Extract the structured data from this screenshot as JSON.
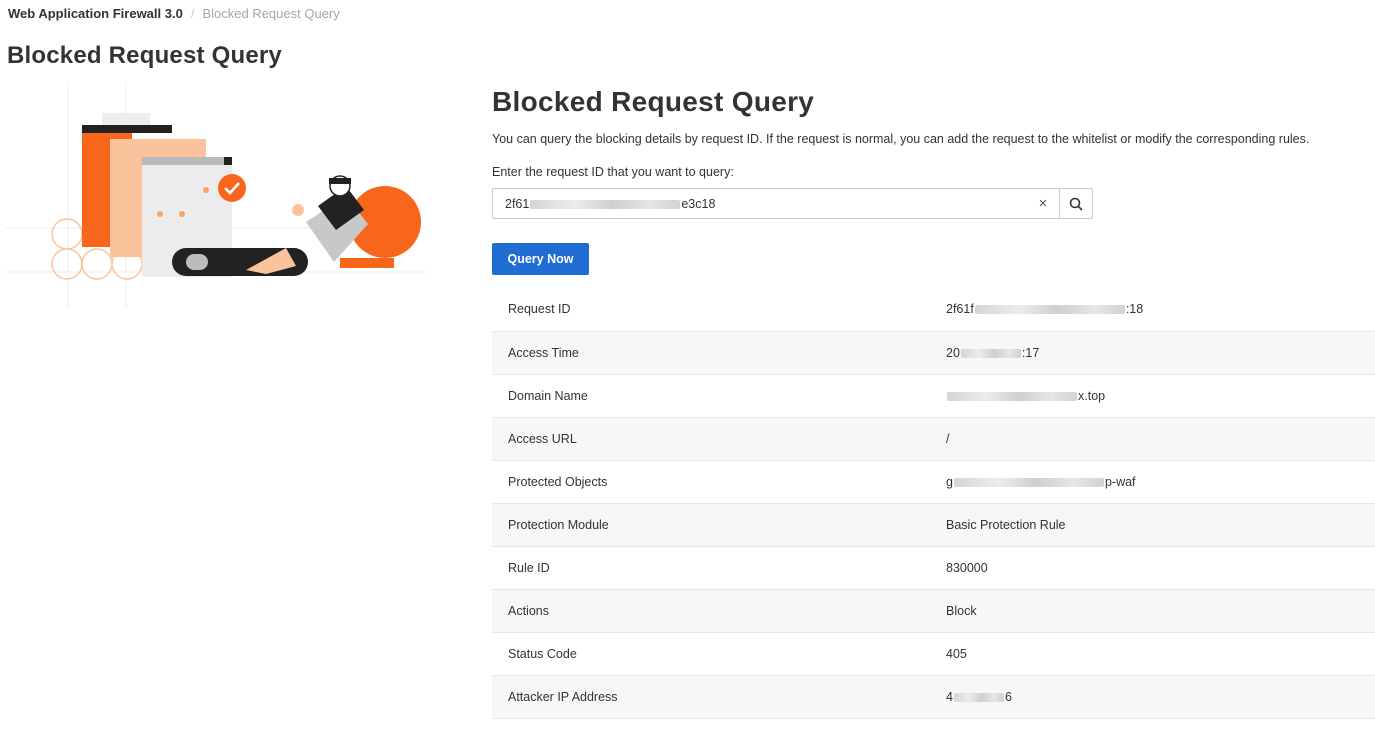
{
  "breadcrumb": {
    "root": "Web Application Firewall 3.0",
    "separator": "/",
    "current": "Blocked Request Query"
  },
  "page_title": "Blocked Request Query",
  "panel": {
    "title": "Blocked Request Query",
    "description": "You can query the blocking details by request ID. If the request is normal, you can add the request to the whitelist or modify the corresponding rules.",
    "input_label": "Enter the request ID that you want to query:",
    "input_value": "2f61",
    "input_value_suffix": "e3c18",
    "clear_icon": "close-icon",
    "search_icon": "search-icon",
    "query_button": "Query Now"
  },
  "details": [
    {
      "label": "Request ID",
      "value_start": "2f61f",
      "value_end": ":18"
    },
    {
      "label": "Access Time",
      "value_start": "20",
      "value_end": ":17"
    },
    {
      "label": "Domain Name",
      "value_start": "",
      "value_end": "x.top"
    },
    {
      "label": "Access URL",
      "value_start": "/",
      "value_end": ""
    },
    {
      "label": "Protected Objects",
      "value_start": "g",
      "value_end": "p-waf"
    },
    {
      "label": "Protection Module",
      "value_start": "Basic Protection Rule",
      "value_end": ""
    },
    {
      "label": "Rule ID",
      "value_start": "830000",
      "value_end": ""
    },
    {
      "label": "Actions",
      "value_start": "Block",
      "value_end": ""
    },
    {
      "label": "Status Code",
      "value_start": "405",
      "value_end": ""
    },
    {
      "label": "Attacker IP Address",
      "value_start": "4",
      "value_end": "6"
    }
  ],
  "colors": {
    "primary": "#1f6cd3",
    "accent_orange": "#f7661b",
    "accent_peach": "#fbc39c"
  }
}
